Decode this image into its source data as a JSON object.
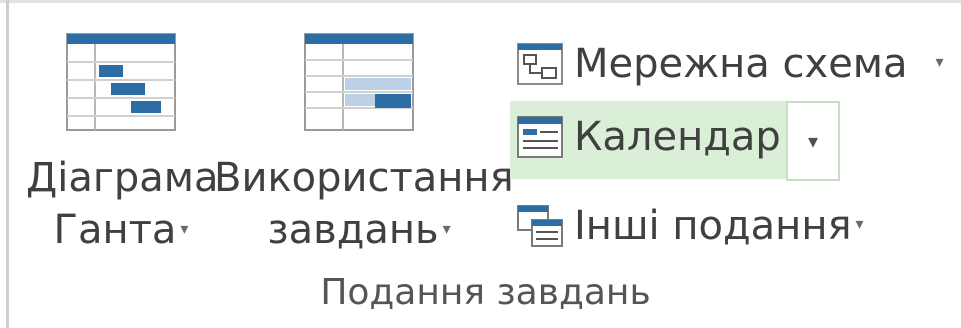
{
  "ribbon": {
    "group_label": "Подання завдань",
    "buttons": {
      "gantt": {
        "line1": "Діаграма",
        "line2": "Ганта",
        "icon": "gantt-chart-icon"
      },
      "usage": {
        "line1": "Використання",
        "line2": "завдань",
        "icon": "task-usage-icon"
      },
      "network": {
        "label": "Мережна схема",
        "icon": "network-diagram-icon"
      },
      "calendar": {
        "label": "Календар",
        "icon": "calendar-icon",
        "selected": true
      },
      "other": {
        "label": "Інші подання",
        "icon": "other-views-icon"
      }
    },
    "dropdown_glyph": "▾",
    "colors": {
      "accent_blue": "#2e6ca4",
      "selected_bg": "#dbeed8",
      "text": "#404040"
    }
  }
}
